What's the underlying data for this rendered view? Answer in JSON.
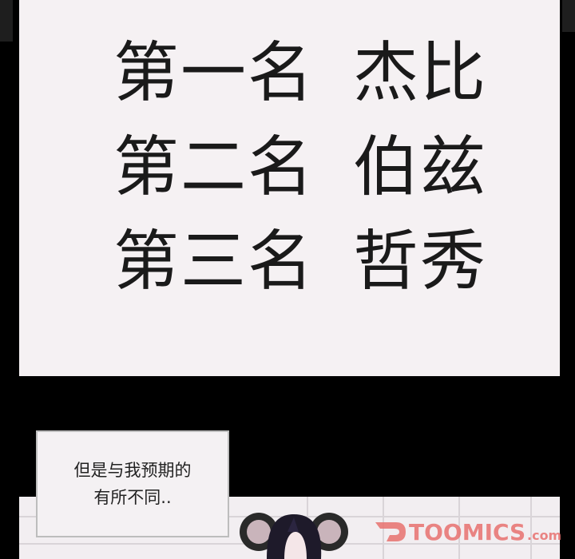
{
  "ranking": {
    "lines": [
      {
        "place": "第一名",
        "name": "杰比"
      },
      {
        "place": "第二名",
        "name": "伯兹"
      },
      {
        "place": "第三名",
        "name": "哲秀"
      }
    ]
  },
  "narration": {
    "line1": "但是与我预期的",
    "line2": "有所不同.."
  },
  "watermark": {
    "text": "TOOMICS",
    "suffix": ".com",
    "color": "#e8716f"
  },
  "colors": {
    "panel": "#f5f1f3",
    "gutter": "#000000",
    "text": "#1a1a1a"
  }
}
